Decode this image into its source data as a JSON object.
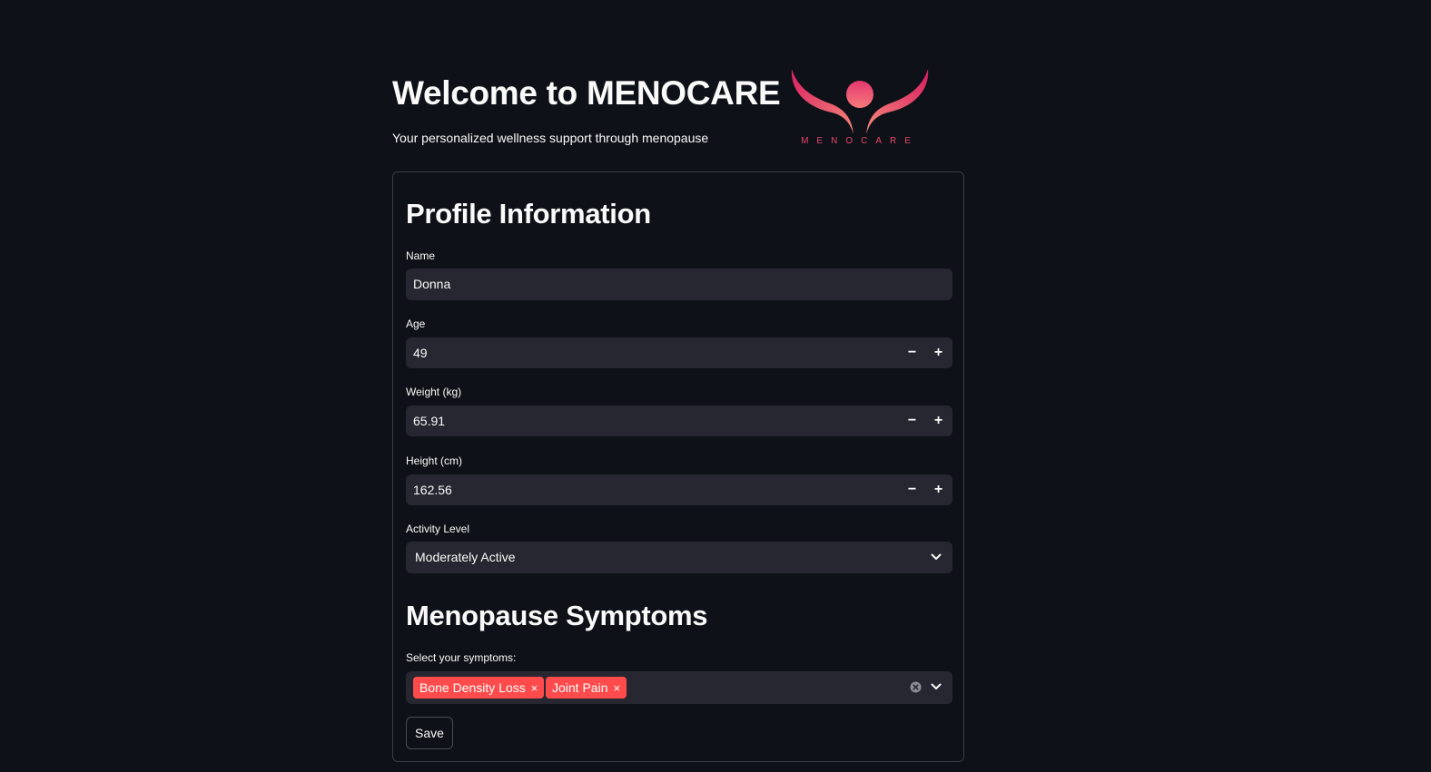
{
  "header": {
    "title": "Welcome to MENOCARE",
    "subtitle": "Your personalized wellness support through menopause",
    "logo_text": "MENOCARE"
  },
  "profile": {
    "section_title": "Profile Information",
    "name": {
      "label": "Name",
      "value": "Donna"
    },
    "age": {
      "label": "Age",
      "value": "49",
      "decrement": "−",
      "increment": "+"
    },
    "weight": {
      "label": "Weight (kg)",
      "value": "65.91",
      "decrement": "−",
      "increment": "+"
    },
    "height": {
      "label": "Height (cm)",
      "value": "162.56",
      "decrement": "−",
      "increment": "+"
    },
    "activity": {
      "label": "Activity Level",
      "selected": "Moderately Active"
    }
  },
  "symptoms": {
    "section_title": "Menopause Symptoms",
    "label": "Select your symptoms:",
    "selected": [
      "Bone Density Loss",
      "Joint Pain"
    ],
    "remove_glyph": "×"
  },
  "actions": {
    "save_label": "Save"
  },
  "colors": {
    "background": "#0e1117",
    "input_bg": "#262730",
    "tag_bg": "#ff4b4b",
    "logo_gradient_top": "#e0306a",
    "logo_gradient_bottom": "#f4877a"
  },
  "icons": [
    "menocare-logo",
    "chevron-down-icon",
    "clear-icon",
    "close-icon",
    "minus-icon",
    "plus-icon"
  ]
}
